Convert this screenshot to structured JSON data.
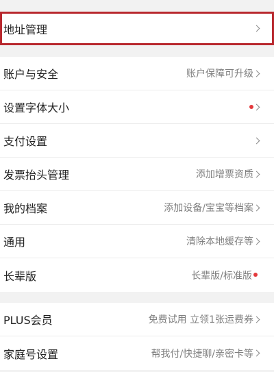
{
  "accent_color": "#e4393c",
  "highlight_color": "#b8282e",
  "groups": [
    {
      "items": [
        {
          "label": "地址管理",
          "value": "",
          "dot": false,
          "chevron": true,
          "highlighted": true
        }
      ]
    },
    {
      "items": [
        {
          "label": "账户与安全",
          "value": "账户保障可升级",
          "dot": false,
          "chevron": true
        },
        {
          "label": "设置字体大小",
          "value": "",
          "dot": true,
          "chevron": true
        },
        {
          "label": "支付设置",
          "value": "",
          "dot": false,
          "chevron": true
        },
        {
          "label": "发票抬头管理",
          "value": "添加增票资质",
          "dot": false,
          "chevron": true
        },
        {
          "label": "我的档案",
          "value": "添加设备/宝宝等档案",
          "dot": false,
          "chevron": true
        },
        {
          "label": "通用",
          "value": "清除本地缓存等",
          "dot": false,
          "chevron": true
        },
        {
          "label": "长辈版",
          "value": "长辈版/标准版",
          "dot": true,
          "chevron": false
        }
      ]
    },
    {
      "items": [
        {
          "label": "PLUS会员",
          "value": "免费试用 立领1张运费券",
          "dot": false,
          "chevron": true
        },
        {
          "label": "家庭号设置",
          "value": "帮我付/快捷聊/亲密卡等",
          "dot": false,
          "chevron": true
        }
      ]
    }
  ]
}
